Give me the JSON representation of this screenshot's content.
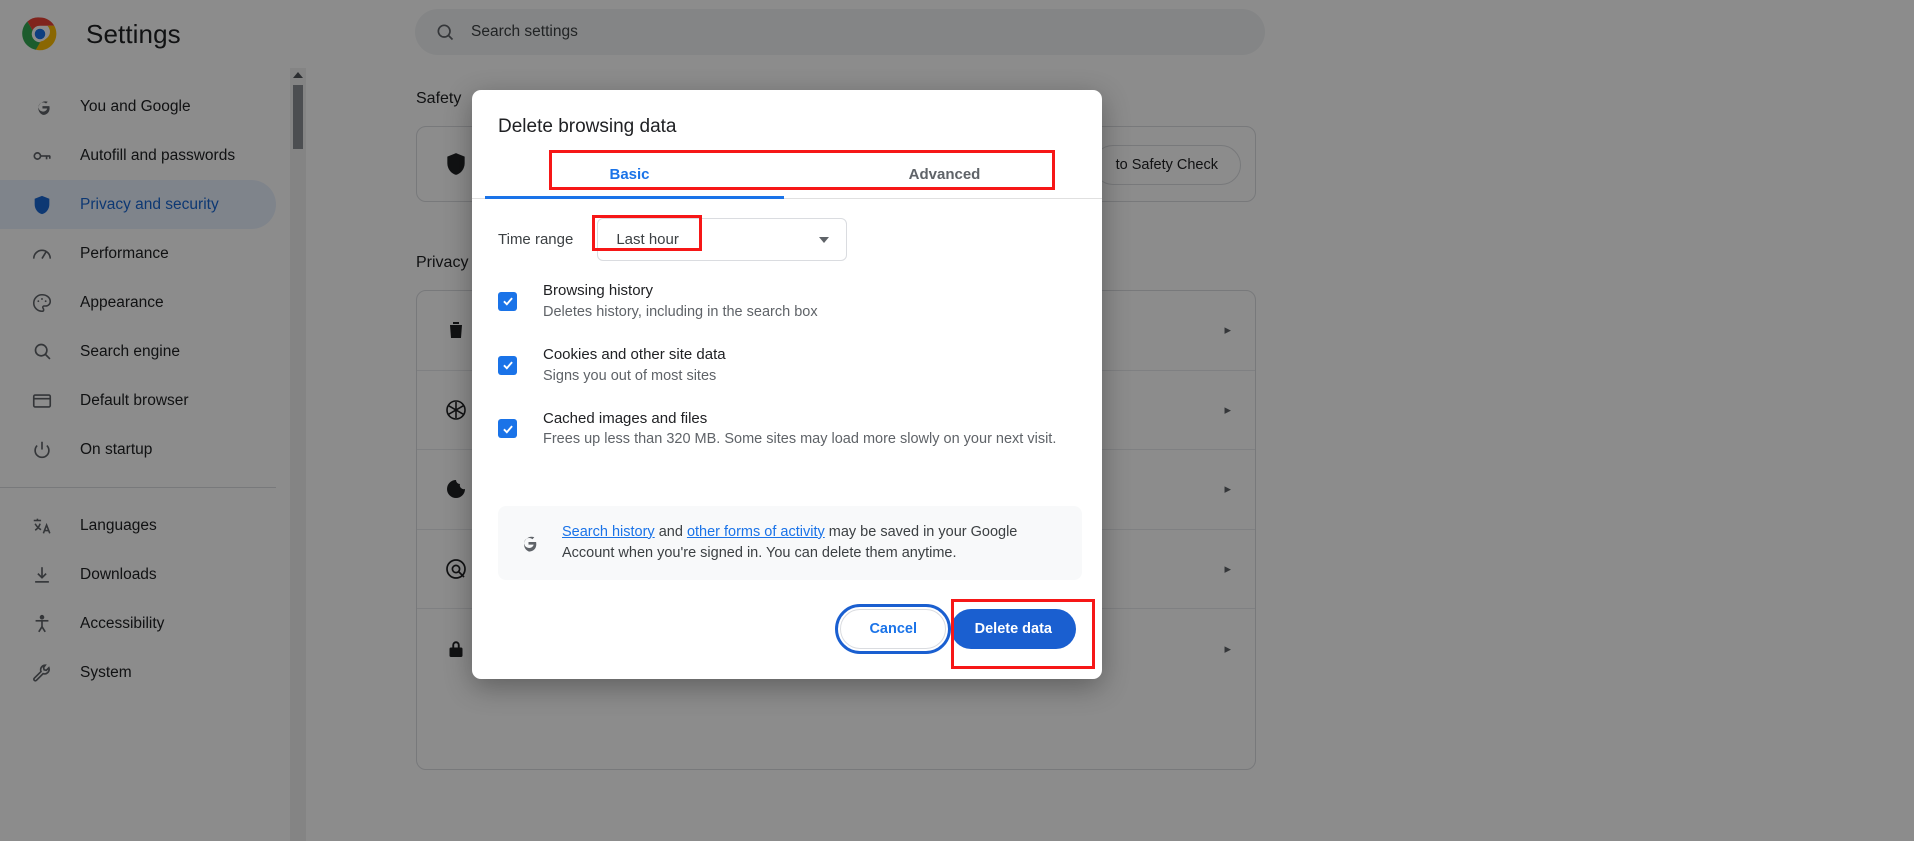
{
  "header": {
    "app_title": "Settings",
    "logo_icon": "chrome-logo-icon",
    "search": {
      "icon": "search-icon",
      "placeholder": "Search settings",
      "value": ""
    }
  },
  "sidebar": {
    "items": [
      {
        "label": "You and Google",
        "icon": "google-g-icon",
        "selected": false
      },
      {
        "label": "Autofill and passwords",
        "icon": "key-icon",
        "selected": false
      },
      {
        "label": "Privacy and security",
        "icon": "shield-icon",
        "selected": true
      },
      {
        "label": "Performance",
        "icon": "speedometer-icon",
        "selected": false
      },
      {
        "label": "Appearance",
        "icon": "palette-icon",
        "selected": false
      },
      {
        "label": "Search engine",
        "icon": "magnifier-icon",
        "selected": false
      },
      {
        "label": "Default browser",
        "icon": "browser-window-icon",
        "selected": false
      },
      {
        "label": "On startup",
        "icon": "power-icon",
        "selected": false
      },
      {
        "label": "Languages",
        "icon": "translate-icon",
        "selected": false
      },
      {
        "label": "Downloads",
        "icon": "download-icon",
        "selected": false
      },
      {
        "label": "Accessibility",
        "icon": "accessibility-icon",
        "selected": false
      },
      {
        "label": "System",
        "icon": "wrench-icon",
        "selected": false
      }
    ],
    "divider_after_index": 7
  },
  "main": {
    "safety_section_title": "Safety",
    "safety_check_button": "to Safety Check",
    "privacy_section_title": "Privacy",
    "row_icons": [
      "trash-icon",
      "asterisk-icon",
      "cookie-icon",
      "target-icon",
      "lock-icon"
    ],
    "chevron": "▸"
  },
  "dialog": {
    "title": "Delete browsing data",
    "tabs": [
      {
        "label": "Basic",
        "active": true
      },
      {
        "label": "Advanced",
        "active": false
      }
    ],
    "time_range": {
      "label": "Time range",
      "value": "Last hour",
      "caret_icon": "chevron-down-icon"
    },
    "checkboxes": [
      {
        "title": "Browsing history",
        "subtitle": "Deletes history, including in the search box",
        "checked": true
      },
      {
        "title": "Cookies and other site data",
        "subtitle": "Signs you out of most sites",
        "checked": true
      },
      {
        "title": "Cached images and files",
        "subtitle": "Frees up less than 320 MB. Some sites may load more slowly on your next visit.",
        "checked": true
      }
    ],
    "google_info": {
      "icon": "google-g-icon",
      "link1": "Search history",
      "mid": " and ",
      "link2": "other forms of activity",
      "tail": " may be saved in your Google Account when you're signed in. You can delete them anytime."
    },
    "buttons": {
      "cancel": "Cancel",
      "delete": "Delete data"
    }
  },
  "annotations": {
    "color": "#f61717",
    "targets": [
      "tabs-row",
      "time-range-value",
      "delete-data-button"
    ]
  }
}
